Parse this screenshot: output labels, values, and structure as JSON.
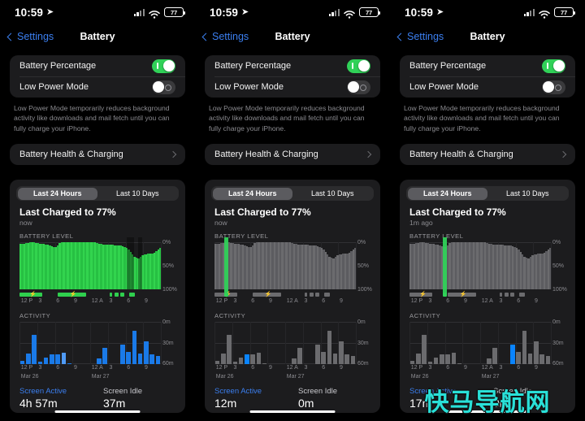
{
  "accent": {
    "blue": "#3b7ff0",
    "green": "#30d158",
    "gray": "#8e8e93",
    "card": "#1c1c1e",
    "watermark": "#29e0d8"
  },
  "statusbar": {
    "time": "10:59",
    "location_icon": "location-arrow-icon",
    "signal_icon": "cellular-signal-icon",
    "wifi_icon": "wifi-icon",
    "battery_level": "77"
  },
  "navbar": {
    "back_label": "Settings",
    "title": "Battery",
    "back_icon": "chevron-left-icon"
  },
  "settings": {
    "battery_percentage_label": "Battery Percentage",
    "battery_percentage_state": "on",
    "low_power_label": "Low Power Mode",
    "low_power_state": "off",
    "footnote": "Low Power Mode temporarily reduces background activity like downloads and mail fetch until you can fully charge your iPhone.",
    "health_label": "Battery Health & Charging",
    "health_chevron_icon": "chevron-right-icon"
  },
  "segments": {
    "last24": "Last 24 Hours",
    "last10": "Last 10 Days",
    "selected": "Last 24 Hours"
  },
  "panels": [
    {
      "last_charged": "Last Charged to 77%",
      "last_charged_sub": "now",
      "screen_active_value": "4h 57m",
      "screen_idle_value": "37m",
      "mode": "all-green",
      "highlight_index": -1
    },
    {
      "last_charged": "Last Charged to 77%",
      "last_charged_sub": "now",
      "screen_active_value": "12m",
      "screen_idle_value": "0m",
      "mode": "dimmed",
      "highlight_index": 5
    },
    {
      "last_charged": "Last Charged to 77%",
      "last_charged_sub": "1m ago",
      "screen_active_value": "17m",
      "screen_idle_value": "0m",
      "mode": "dimmed",
      "highlight_index": 17
    }
  ],
  "labels": {
    "battery_level_title": "BATTERY LEVEL",
    "activity_title": "ACTIVITY",
    "screen_active": "Screen Active",
    "screen_idle": "Screen Idle",
    "date_left": "Mar 26",
    "date_right": "Mar 27"
  },
  "watermark": "快马导航网",
  "chart_data": {
    "battery_level": {
      "type": "area",
      "title": "BATTERY LEVEL",
      "ylabel": "",
      "ylim": [
        0,
        100
      ],
      "yticks": [
        0,
        50,
        100
      ],
      "ytick_labels": [
        "0%",
        "50%",
        "100%"
      ],
      "xtick_labels": [
        "12 P",
        "3",
        "6",
        "9",
        "12 A",
        "3",
        "6",
        "9"
      ],
      "grid": true,
      "values": [
        97,
        98,
        98,
        99,
        99,
        100,
        100,
        100,
        99,
        99,
        98,
        98,
        97,
        96,
        95,
        93,
        92,
        90,
        91,
        94,
        99,
        100,
        100,
        100,
        100,
        100,
        100,
        100,
        100,
        100,
        100,
        100,
        100,
        100,
        100,
        100,
        100,
        100,
        100,
        99,
        98,
        97,
        96,
        96,
        95,
        95,
        95,
        95,
        94,
        94,
        93,
        93,
        92,
        91,
        89,
        85,
        80,
        74,
        70,
        68,
        66,
        70,
        73,
        74,
        75,
        76,
        76,
        77,
        79,
        82,
        85,
        88
      ],
      "charging_segments": [
        {
          "start": 0.0,
          "end": 0.16,
          "bolt_at": 0.07
        },
        {
          "start": 0.27,
          "end": 0.47,
          "bolt_at": 0.355
        },
        {
          "start": 0.64,
          "end": 0.655
        },
        {
          "start": 0.675,
          "end": 0.7
        },
        {
          "start": 0.715,
          "end": 0.74
        },
        {
          "start": 0.775,
          "end": 0.815
        }
      ]
    },
    "activity": {
      "type": "bar",
      "title": "ACTIVITY",
      "ylabel": "",
      "ylim": [
        0,
        60
      ],
      "yticks": [
        0,
        30,
        60
      ],
      "ytick_labels": [
        "0m",
        "30m",
        "60m"
      ],
      "xtick_labels": [
        "12 P",
        "3",
        "6",
        "9",
        "12 A",
        "3",
        "6",
        "9"
      ],
      "grid": true,
      "values": [
        5,
        16,
        42,
        4,
        10,
        14,
        14,
        17,
        2,
        0,
        0,
        0,
        0,
        8,
        24,
        0,
        0,
        28,
        18,
        48,
        16,
        33,
        14,
        12
      ]
    }
  }
}
